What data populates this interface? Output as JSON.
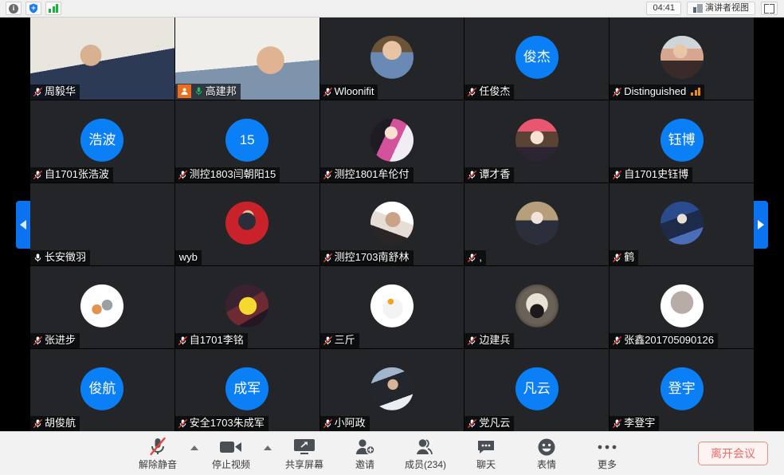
{
  "topbar": {
    "info_glyph": "i",
    "info_name": "info-icon",
    "shield_name": "security-shield-icon",
    "network_name": "network-quality-icon",
    "timer": "04:41",
    "view_label": "演讲者视图",
    "fullscreen_name": "fullscreen-icon"
  },
  "gallery": {
    "prev_label": "◀",
    "next_label": "▶",
    "participants": [
      {
        "name": "周毅华",
        "kind": "video",
        "mic": "muted",
        "host": false,
        "net": false,
        "photo": "office-man-blue-striped-shirt"
      },
      {
        "name": "高建邦",
        "kind": "video",
        "mic": "active",
        "host": true,
        "net": false,
        "photo": "lab-room-man-glasses"
      },
      {
        "name": "Wloonifit",
        "kind": "photo",
        "mic": "muted",
        "host": false,
        "net": false,
        "photo": "toddler-denim-jacket"
      },
      {
        "name": "任俊杰",
        "kind": "initials",
        "mic": "muted",
        "host": false,
        "net": false,
        "initials": "俊杰"
      },
      {
        "name": "Distinguished",
        "kind": "photo",
        "mic": "muted",
        "host": false,
        "net": true,
        "photo": "girl-striped-shirt-dark"
      },
      {
        "name": "自1701张浩波",
        "kind": "initials",
        "mic": "muted",
        "host": false,
        "net": false,
        "initials": "浩波"
      },
      {
        "name": "测控1803闫朝阳15",
        "kind": "initials",
        "mic": "muted",
        "host": false,
        "net": false,
        "initials": "15"
      },
      {
        "name": "测控1801牟伦付",
        "kind": "photo",
        "mic": "muted",
        "host": false,
        "net": false,
        "photo": "anime-girl-pink-jacket"
      },
      {
        "name": "谭才香",
        "kind": "photo",
        "mic": "muted",
        "host": false,
        "net": false,
        "photo": "anime-girl-red-hat"
      },
      {
        "name": "自1701史钰博",
        "kind": "initials",
        "mic": "muted",
        "host": false,
        "net": false,
        "initials": "钰博"
      },
      {
        "name": "长安徵羽",
        "kind": "photo",
        "mic": "unmuted",
        "host": false,
        "net": false,
        "photo": "illustration-person-bun-hair"
      },
      {
        "name": "wyb",
        "kind": "photo",
        "mic": "none",
        "host": false,
        "net": false,
        "photo": "cartoon-figure-red-circle"
      },
      {
        "name": "测控1703南舒林",
        "kind": "photo",
        "mic": "muted",
        "host": false,
        "net": false,
        "photo": "backlit-curly-hair-woman"
      },
      {
        "name": ",",
        "kind": "photo",
        "mic": "muted",
        "host": false,
        "net": false,
        "photo": "anime-boy-white-hood"
      },
      {
        "name": "鹤",
        "kind": "photo",
        "mic": "muted",
        "host": false,
        "net": false,
        "photo": "anime-blue-armor-character"
      },
      {
        "name": "张进步",
        "kind": "photo",
        "mic": "muted",
        "host": false,
        "net": false,
        "photo": "two-cats-drawing"
      },
      {
        "name": "自1701李铭",
        "kind": "photo",
        "mic": "muted",
        "host": false,
        "net": false,
        "photo": "pikachu-costume"
      },
      {
        "name": "三斤",
        "kind": "photo",
        "mic": "muted",
        "host": false,
        "net": false,
        "photo": "cartoon-duck-with-phone"
      },
      {
        "name": "边建兵",
        "kind": "photo",
        "mic": "muted",
        "host": false,
        "net": false,
        "photo": "dark-portrait-suit-man"
      },
      {
        "name": "张鑫201705090126",
        "kind": "photo",
        "mic": "muted",
        "host": false,
        "net": false,
        "photo": "grey-cartoon-blob-face"
      },
      {
        "name": "胡俊航",
        "kind": "initials",
        "mic": "muted",
        "host": false,
        "net": false,
        "initials": "俊航"
      },
      {
        "name": "安全1703朱成军",
        "kind": "initials",
        "mic": "muted",
        "host": false,
        "net": false,
        "initials": "成军"
      },
      {
        "name": "小阿政",
        "kind": "photo",
        "mic": "muted",
        "host": false,
        "net": false,
        "photo": "young-man-dark-hoodie-snow"
      },
      {
        "name": "党凡云",
        "kind": "initials",
        "mic": "muted",
        "host": false,
        "net": false,
        "initials": "凡云"
      },
      {
        "name": "李登宇",
        "kind": "initials",
        "mic": "muted",
        "host": false,
        "net": false,
        "initials": "登宇"
      }
    ]
  },
  "toolbar": {
    "items": [
      {
        "label": "解除静音",
        "icon": "microphone-muted-icon",
        "caret": true
      },
      {
        "label": "停止视频",
        "icon": "video-camera-icon",
        "caret": true
      },
      {
        "label": "共享屏幕",
        "icon": "share-screen-icon",
        "caret": false
      },
      {
        "label": "邀请",
        "icon": "invite-person-icon",
        "caret": false
      },
      {
        "label": "成员(234)",
        "icon": "participants-icon",
        "caret": false
      },
      {
        "label": "聊天",
        "icon": "chat-bubble-icon",
        "caret": false
      },
      {
        "label": "表情",
        "icon": "emoji-smile-icon",
        "caret": false
      },
      {
        "label": "更多",
        "icon": "more-dots-icon",
        "caret": false
      }
    ],
    "leave_label": "离开会议"
  },
  "colors": {
    "avatar_blue": "#0b7ff5",
    "host_orange": "#ef6c1b",
    "leave_red": "#ee6a62",
    "pager_blue": "#0b72f0",
    "mic_green": "#24bb5b",
    "net_orange": "#f08a1d"
  }
}
